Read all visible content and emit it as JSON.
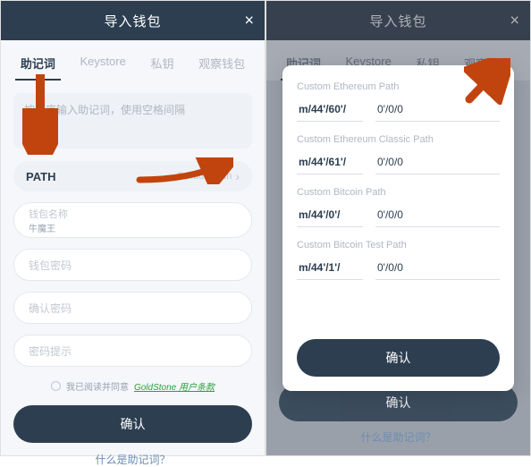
{
  "left": {
    "header": {
      "title": "导入钱包",
      "close": "×"
    },
    "tabs": [
      "助记词",
      "Keystore",
      "私钥",
      "观察钱包"
    ],
    "mnemonic_placeholder": "按顺序输入助记词，使用空格间隔",
    "path": {
      "label": "PATH",
      "default": "Default Path"
    },
    "fields": {
      "name_label": "钱包名称",
      "name_value": "牛魔王",
      "pwd_label": "钱包密码",
      "pwd_confirm_label": "确认密码",
      "pwd_hint_label": "密码提示"
    },
    "agree": {
      "prefix": "我已阅读并同意",
      "link": "GoldStone 用户条款"
    },
    "confirm": "确认",
    "help": "什么是助记词？"
  },
  "right": {
    "header": {
      "title": "导入钱包",
      "close": "×"
    },
    "tabs": [
      "助记词",
      "Keystore",
      "私钥",
      "观察钱包"
    ],
    "modal": {
      "groups": [
        {
          "label": "Custom Ethereum Path",
          "left": "m/44'/60'/",
          "right": "0'/0/0"
        },
        {
          "label": "Custom Ethereum Classic Path",
          "left": "m/44'/61'/",
          "right": "0'/0/0"
        },
        {
          "label": "Custom Bitcoin Path",
          "left": "m/44'/0'/",
          "right": "0'/0/0"
        },
        {
          "label": "Custom Bitcoin Test Path",
          "left": "m/44'/1'/",
          "right": "0'/0/0"
        }
      ],
      "confirm": "确认"
    },
    "ghost_confirm": "确认",
    "ghost_help": "什么是助记词？"
  }
}
